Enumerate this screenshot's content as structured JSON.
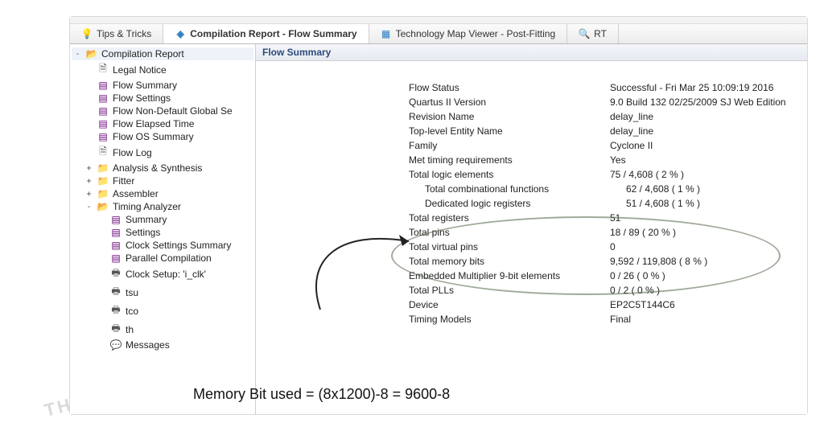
{
  "tabs": {
    "tips": {
      "label": "Tips & Tricks"
    },
    "report": {
      "label": "Compilation Report - Flow Summary"
    },
    "tmv": {
      "label": "Technology Map Viewer - Post-Fitting"
    },
    "rt": {
      "label": "RT"
    }
  },
  "tree": {
    "root": "Compilation Report",
    "legal": "Legal Notice",
    "flowSummary": "Flow Summary",
    "flowSettings": "Flow Settings",
    "flowNDG": "Flow Non-Default Global Se",
    "flowElapsed": "Flow Elapsed Time",
    "flowOS": "Flow OS Summary",
    "flowLog": "Flow Log",
    "anSyn": "Analysis & Synthesis",
    "fitter": "Fitter",
    "asm": "Assembler",
    "timing": "Timing Analyzer",
    "t_summary": "Summary",
    "t_settings": "Settings",
    "t_clockset": "Clock Settings Summary",
    "t_parcomp": "Parallel Compilation",
    "t_clksetup": "Clock Setup: 'i_clk'",
    "t_tsu": "tsu",
    "t_tco": "tco",
    "t_th": "th",
    "t_msgs": "Messages"
  },
  "panel": {
    "title": "Flow Summary"
  },
  "rows": {
    "flowStatus": {
      "k": "Flow Status",
      "v": "Successful - Fri Mar 25 10:09:19 2016"
    },
    "quartus": {
      "k": "Quartus II Version",
      "v": "9.0 Build 132 02/25/2009 SJ Web Edition"
    },
    "revName": {
      "k": "Revision Name",
      "v": "delay_line"
    },
    "topEntity": {
      "k": "Top-level Entity Name",
      "v": "delay_line"
    },
    "family": {
      "k": "Family",
      "v": "Cyclone II"
    },
    "metTiming": {
      "k": "Met timing requirements",
      "v": "Yes"
    },
    "tle": {
      "k": "Total logic elements",
      "v": "75 / 4,608 ( 2 % )"
    },
    "tcf": {
      "k": "Total combinational functions",
      "v": "62 / 4,608 ( 1 % )"
    },
    "dlr": {
      "k": "Dedicated logic registers",
      "v": "51 / 4,608 ( 1 % )"
    },
    "tregs": {
      "k": "Total registers",
      "v": "51"
    },
    "tpins": {
      "k": "Total pins",
      "v": "18 / 89 ( 20 % )"
    },
    "tvpins": {
      "k": "Total virtual pins",
      "v": "0"
    },
    "tmbits": {
      "k": "Total memory bits",
      "v": "9,592 / 119,808 ( 8 % )"
    },
    "emb9": {
      "k": "Embedded Multiplier 9-bit elements",
      "v": "0 / 26 ( 0 % )"
    },
    "tplls": {
      "k": "Total PLLs",
      "v": "0 / 2 ( 0 % )"
    },
    "device": {
      "k": "Device",
      "v": "EP2C5T144C6"
    },
    "tmodels": {
      "k": "Timing Models",
      "v": "Final"
    }
  },
  "annotation": {
    "memlabel": "Memory Bit used = (8x1200)-8 = 9600-8"
  }
}
